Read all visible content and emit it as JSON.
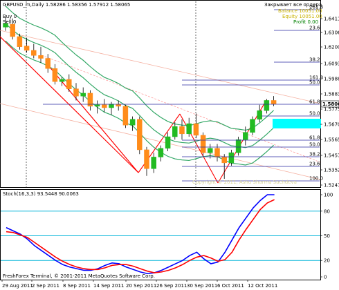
{
  "main_panel": {
    "header": "GBPUSD_m,Daily  1.58286 1.58356 1.57912 1.58065",
    "buy_text": "Buy 0",
    "sell_text": "Sell 0",
    "close_all_text": "Закрывает все ордера",
    "balance_text": "Balance 10051.00",
    "equity_text": "Equity 10051.00",
    "profit_text": "Profit 0.00",
    "watermark": "Copyright © 2011, Ashu Sharma Sachdeva",
    "fib_levels": [
      "261.8",
      "23.6",
      "38.2",
      "61.8",
      "50.0",
      "100.0",
      "161.8",
      "50.0",
      "61.8",
      "50.0",
      "38.2",
      "23.6",
      "100.0"
    ],
    "price_ticks": [
      "1.64110",
      "1.63060",
      "1.62000",
      "1.60930",
      "1.59880",
      "1.58830",
      "1.57755",
      "1.56700",
      "1.55650",
      "1.54570",
      "1.53520",
      "1.52470"
    ],
    "current_price": "1.58065"
  },
  "indicator_panel": {
    "label": "Stoch(16,3,3) 93.5448 90.0063",
    "ticks": [
      "100",
      "80",
      "50",
      "20",
      "0"
    ],
    "colors": {
      "main": "#0000ff",
      "signal": "#ff0000",
      "levels": "#00b4d8"
    }
  },
  "footer": {
    "copyright": "FreshForex Terminal, © 2001-2011 MetaQuotes Software Corp."
  },
  "time_axis": {
    "labels": [
      "29 Aug 2011",
      "2 Sep 2011",
      "8 Sep 2011",
      "14 Sep 2011",
      "20 Sep 2011",
      "26 Sep 2011",
      "30 Sep 2011",
      "6 Oct 2011",
      "12 Oct 2011"
    ]
  },
  "colors": {
    "bull": "#22bb22",
    "bear": "#ff8c1a",
    "ma": "#33a866",
    "trend": "#ff0000",
    "fib": "#2a2aa0",
    "cyan_zone": "#00ffff"
  },
  "chart_data": {
    "type": "candlestick",
    "symbol": "GBPUSD_m",
    "timeframe": "Daily",
    "ylim": [
      1.5247,
      1.6465
    ],
    "candles": [
      {
        "o": 1.6335,
        "h": 1.6405,
        "l": 1.631,
        "c": 1.636
      },
      {
        "o": 1.6355,
        "h": 1.6395,
        "l": 1.625,
        "c": 1.627
      },
      {
        "o": 1.627,
        "h": 1.629,
        "l": 1.618,
        "c": 1.62
      },
      {
        "o": 1.6205,
        "h": 1.626,
        "l": 1.616,
        "c": 1.6175
      },
      {
        "o": 1.6175,
        "h": 1.622,
        "l": 1.612,
        "c": 1.614
      },
      {
        "o": 1.614,
        "h": 1.62,
        "l": 1.609,
        "c": 1.612
      },
      {
        "o": 1.612,
        "h": 1.615,
        "l": 1.602,
        "c": 1.605
      },
      {
        "o": 1.605,
        "h": 1.608,
        "l": 1.594,
        "c": 1.596
      },
      {
        "o": 1.596,
        "h": 1.599,
        "l": 1.593,
        "c": 1.5975
      },
      {
        "o": 1.5975,
        "h": 1.601,
        "l": 1.589,
        "c": 1.591
      },
      {
        "o": 1.591,
        "h": 1.595,
        "l": 1.583,
        "c": 1.586
      },
      {
        "o": 1.586,
        "h": 1.592,
        "l": 1.582,
        "c": 1.588
      },
      {
        "o": 1.588,
        "h": 1.59,
        "l": 1.576,
        "c": 1.579
      },
      {
        "o": 1.579,
        "h": 1.583,
        "l": 1.574,
        "c": 1.58
      },
      {
        "o": 1.58,
        "h": 1.584,
        "l": 1.575,
        "c": 1.578
      },
      {
        "o": 1.578,
        "h": 1.582,
        "l": 1.573,
        "c": 1.5805
      },
      {
        "o": 1.5805,
        "h": 1.583,
        "l": 1.576,
        "c": 1.579
      },
      {
        "o": 1.579,
        "h": 1.58,
        "l": 1.564,
        "c": 1.566
      },
      {
        "o": 1.566,
        "h": 1.572,
        "l": 1.562,
        "c": 1.57
      },
      {
        "o": 1.57,
        "h": 1.572,
        "l": 1.546,
        "c": 1.549
      },
      {
        "o": 1.549,
        "h": 1.551,
        "l": 1.531,
        "c": 1.536
      },
      {
        "o": 1.536,
        "h": 1.547,
        "l": 1.533,
        "c": 1.544
      },
      {
        "o": 1.544,
        "h": 1.552,
        "l": 1.541,
        "c": 1.55
      },
      {
        "o": 1.55,
        "h": 1.561,
        "l": 1.548,
        "c": 1.558
      },
      {
        "o": 1.558,
        "h": 1.568,
        "l": 1.556,
        "c": 1.565
      },
      {
        "o": 1.565,
        "h": 1.57,
        "l": 1.556,
        "c": 1.56
      },
      {
        "o": 1.56,
        "h": 1.571,
        "l": 1.558,
        "c": 1.567
      },
      {
        "o": 1.567,
        "h": 1.574,
        "l": 1.557,
        "c": 1.559
      },
      {
        "o": 1.559,
        "h": 1.561,
        "l": 1.544,
        "c": 1.547
      },
      {
        "o": 1.547,
        "h": 1.553,
        "l": 1.543,
        "c": 1.55
      },
      {
        "o": 1.55,
        "h": 1.553,
        "l": 1.541,
        "c": 1.544
      },
      {
        "o": 1.544,
        "h": 1.546,
        "l": 1.529,
        "c": 1.54
      },
      {
        "o": 1.54,
        "h": 1.549,
        "l": 1.538,
        "c": 1.547
      },
      {
        "o": 1.547,
        "h": 1.558,
        "l": 1.545,
        "c": 1.556
      },
      {
        "o": 1.556,
        "h": 1.565,
        "l": 1.552,
        "c": 1.561
      },
      {
        "o": 1.561,
        "h": 1.572,
        "l": 1.559,
        "c": 1.57
      },
      {
        "o": 1.57,
        "h": 1.58,
        "l": 1.568,
        "c": 1.576
      },
      {
        "o": 1.576,
        "h": 1.584,
        "l": 1.574,
        "c": 1.583
      },
      {
        "o": 1.583,
        "h": 1.586,
        "l": 1.579,
        "c": 1.5806
      }
    ],
    "stochastic": {
      "main": [
        60,
        56,
        52,
        46,
        38,
        32,
        26,
        20,
        15,
        12,
        10,
        8,
        8,
        10,
        14,
        17,
        16,
        12,
        9,
        6,
        4,
        5,
        8,
        12,
        16,
        20,
        26,
        30,
        22,
        16,
        18,
        30,
        45,
        60,
        72,
        84,
        93,
        100,
        100
      ],
      "signal": [
        55,
        54,
        51,
        48,
        42,
        36,
        30,
        24,
        19,
        15,
        12,
        10,
        9,
        9,
        11,
        14,
        15,
        15,
        13,
        10,
        7,
        5,
        6,
        8,
        11,
        15,
        20,
        24,
        26,
        23,
        19,
        21,
        30,
        45,
        58,
        70,
        82,
        90,
        94
      ]
    }
  }
}
